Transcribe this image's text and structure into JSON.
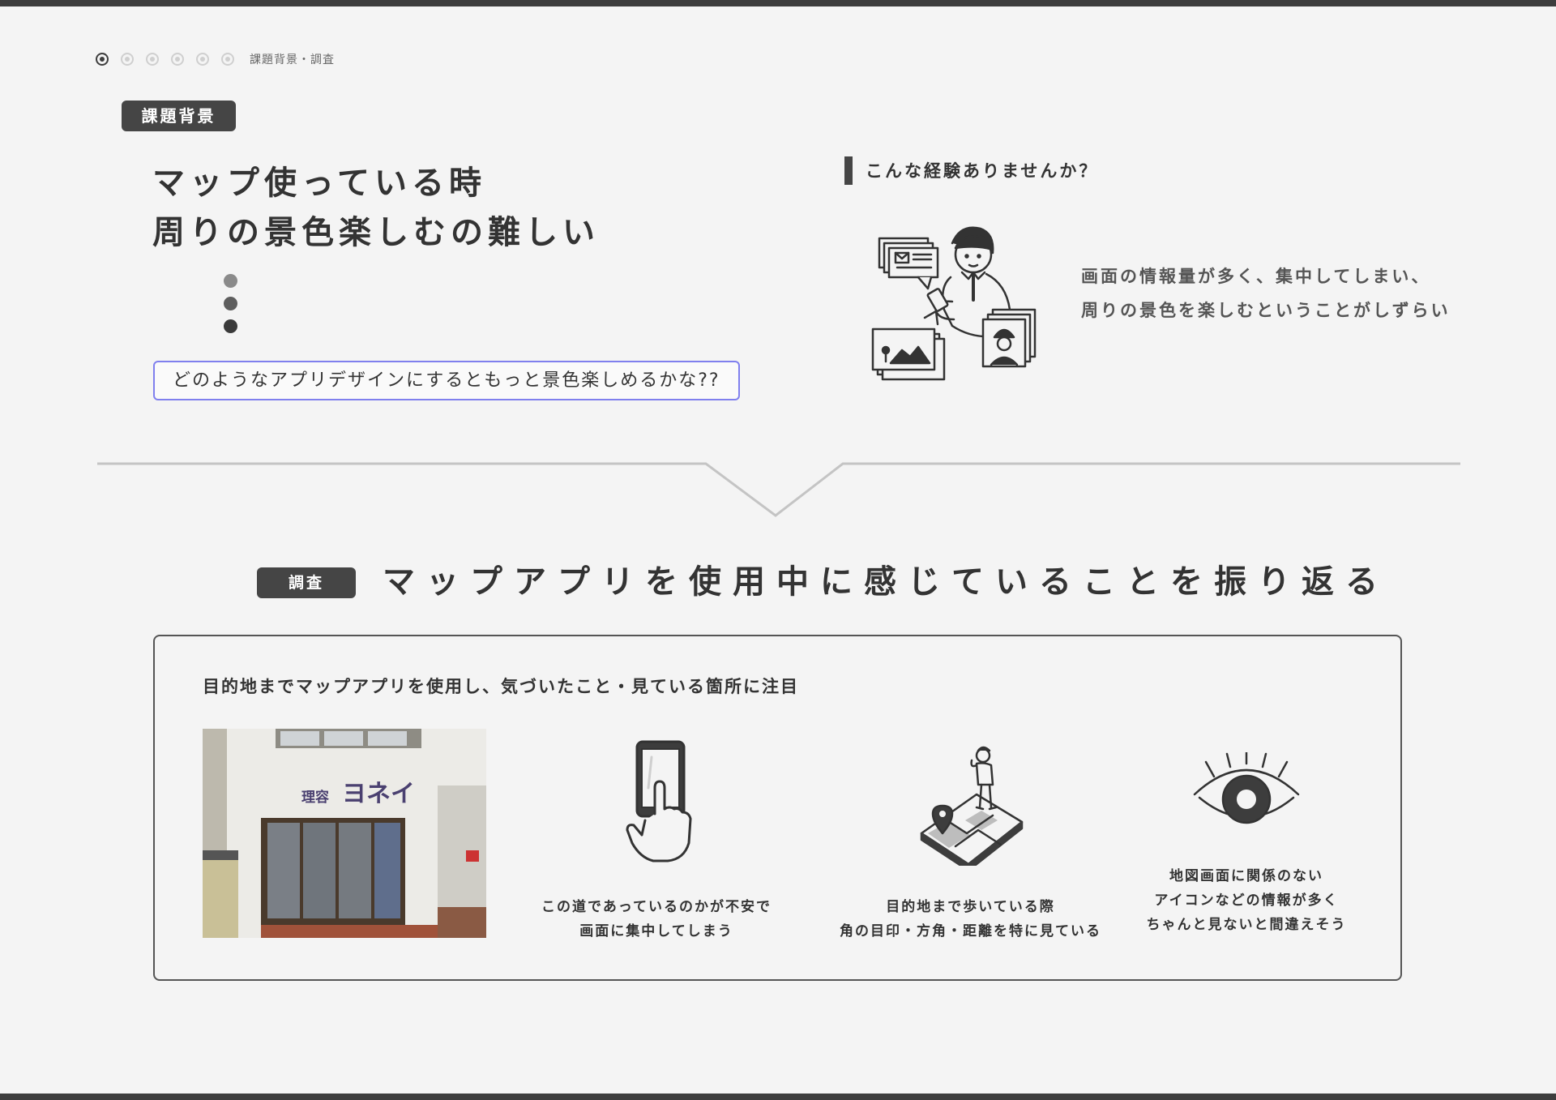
{
  "progress": {
    "steps": 6,
    "active_index": 0,
    "label": "課題背景・調査"
  },
  "background": {
    "tag": "課題背景",
    "headline_lines": [
      "マップ使っている時",
      "周りの景色楽しむの難しい"
    ],
    "question": "どのようなアプリデザインにするともっと景色楽しめるかな??"
  },
  "experience": {
    "title": "こんな経験ありませんか？",
    "desc_lines": [
      "画面の情報量が多く、集中してしまい、",
      "周りの景色を楽しむということがしずらい"
    ]
  },
  "survey": {
    "tag": "調査",
    "title": "マップアプリを使用中に感じていることを振り返る",
    "intro": "目的地までマップアプリを使用し、気づいたこと・見ている箇所に注目",
    "photo": {
      "sign_small": "理容",
      "sign_large": "ヨネイ"
    },
    "findings": [
      {
        "icon": "smartphone-tap-icon",
        "lines": [
          "この道であっているのかが不安で",
          "画面に集中してしまう"
        ]
      },
      {
        "icon": "person-on-map-icon",
        "lines": [
          "目的地まで歩いている際",
          "角の目印・方角・距離を特に見ている"
        ]
      },
      {
        "icon": "eye-icon",
        "lines": [
          "地図画面に関係のない",
          "アイコンなどの情報が多く",
          "ちゃんと見ないと間違えそう"
        ]
      }
    ]
  },
  "colors": {
    "bar": "#3d3d3d",
    "tag": "#454545",
    "question_border": "#8080ee",
    "background": "#f4f4f4",
    "dots": [
      "#8a8a8a",
      "#5e5e5e",
      "#3a3a3a"
    ]
  }
}
